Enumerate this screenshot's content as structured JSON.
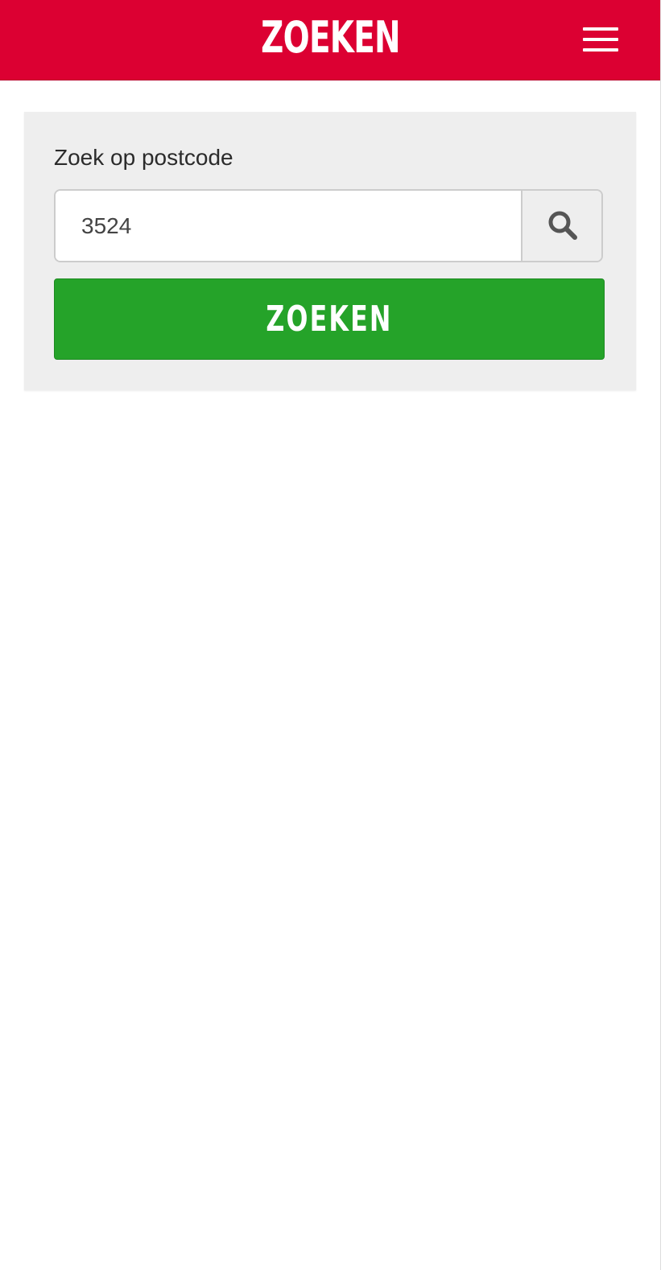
{
  "header": {
    "title": "ZOEKEN",
    "menu_icon": "hamburger-menu-icon"
  },
  "search_panel": {
    "label": "Zoek op postcode",
    "postcode_value": "3524",
    "search_icon": "magnifier-icon",
    "submit_label": "ZOEKEN"
  },
  "colors": {
    "header_background": "#dc0032",
    "panel_background": "#eeeeee",
    "submit_background": "#25a329",
    "icon_color": "#555555"
  }
}
